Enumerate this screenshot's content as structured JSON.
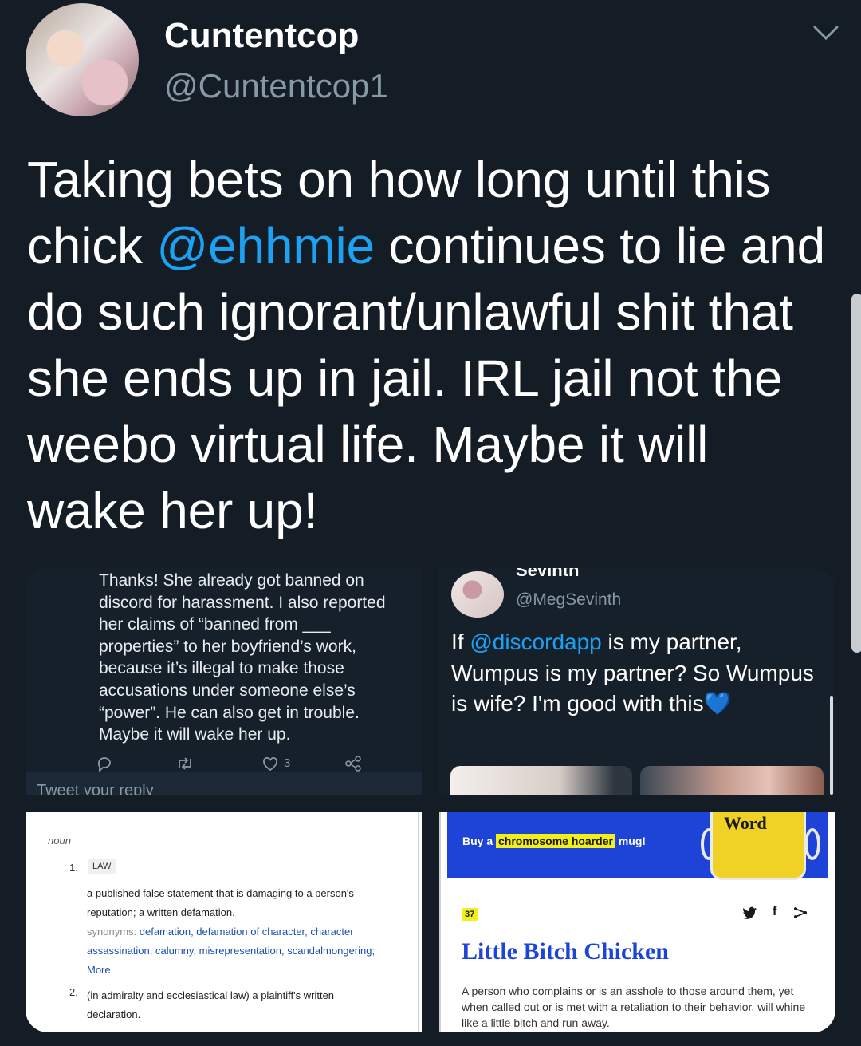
{
  "tweet": {
    "display_name": "Cuntentcop",
    "handle": "@Cuntentcop1",
    "text_part1": "Taking bets on how long until this chick ",
    "mention": "@ehhmie",
    "text_part2": " continues to lie and do such ignorant/unlawful shit that she ends up in jail. IRL jail not the weebo virtual life. Maybe it will wake her up!",
    "mention_color": "#1da1f2",
    "background": "#141d26",
    "icons": [
      "chevron-down-icon"
    ]
  },
  "media": {
    "panel1": {
      "text": "Thanks! She already got banned on discord for harassment. I also reported her claims of “banned from ___ properties” to her boyfriend’s work, because it’s illegal to make those accusations under someone else’s “power”. He can also get in trouble. Maybe it will wake her up.",
      "like_count": "3",
      "reply_placeholder": "Tweet your reply",
      "icons": [
        "reply-icon",
        "retweet-icon",
        "like-icon",
        "share-icon"
      ]
    },
    "panel2": {
      "name": "Sevinth",
      "handle": "@MegSevinth",
      "text_part1": "If ",
      "mention": "@discordapp",
      "text_part2": " is my partner, Wumpus is my partner? So Wumpus is wife? I'm good with this",
      "emoji": "💙"
    },
    "panel3": {
      "pos": "noun",
      "def1_num": "1.",
      "def1_tag": "LAW",
      "def1_text": "a published false statement that is damaging to a person's reputation; a written defamation.",
      "synonyms_label": "synonyms:",
      "synonyms": "defamation, defamation of character, character assassination, calumny, misrepresentation, scandalmongering;",
      "more": "More",
      "def2_num": "2.",
      "def2_text": "(in admiralty and ecclesiastical law) a plaintiff's written declaration."
    },
    "panel4": {
      "ad_prefix": "Buy a",
      "ad_highlight": "chromosome hoarder",
      "ad_suffix": "mug!",
      "mug_word": "Word",
      "badge": "37",
      "share_icons": [
        "twitter-icon",
        "facebook-icon",
        "share-icon"
      ],
      "title": "Little Bitch Chicken",
      "definition": "A person who complains or is an asshole to those around them, yet when called out or is met with a retaliation to their behavior, will whine like a little bitch and run away.",
      "banner_color": "#1d44d6",
      "highlight_color": "#f3ef18"
    }
  }
}
